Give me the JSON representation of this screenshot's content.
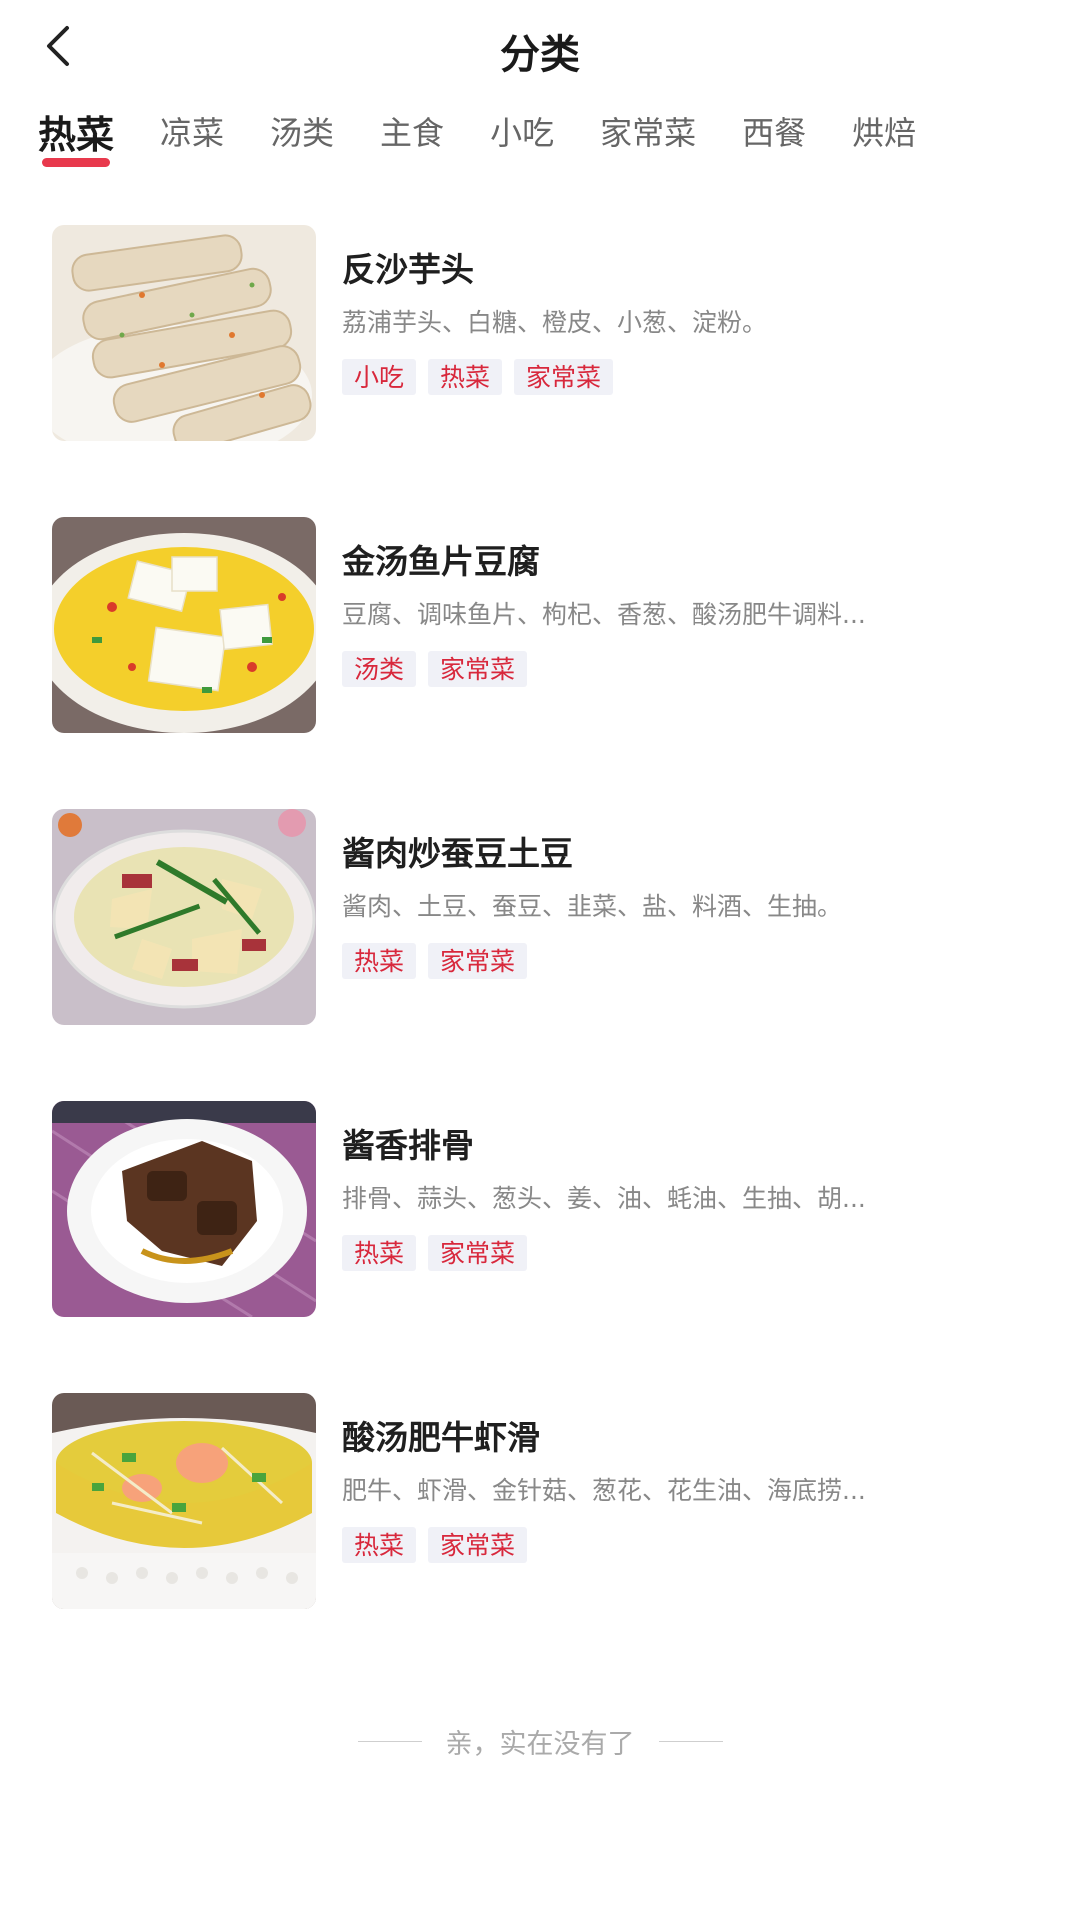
{
  "header": {
    "title": "分类",
    "back_icon": "chevron-left-icon"
  },
  "tabs": [
    {
      "label": "热菜",
      "active": true
    },
    {
      "label": "凉菜",
      "active": false
    },
    {
      "label": "汤类",
      "active": false
    },
    {
      "label": "主食",
      "active": false
    },
    {
      "label": "小吃",
      "active": false
    },
    {
      "label": "家常菜",
      "active": false
    },
    {
      "label": "西餐",
      "active": false
    },
    {
      "label": "烘焙",
      "active": false
    }
  ],
  "accent_color": "#e8394d",
  "recipes": [
    {
      "name": "反沙芋头",
      "ingredients": "荔浦芋头、白糖、橙皮、小葱、淀粉。",
      "tags": [
        "小吃",
        "热菜",
        "家常菜"
      ]
    },
    {
      "name": "金汤鱼片豆腐",
      "ingredients": "豆腐、调味鱼片、枸杞、香葱、酸汤肥牛调料...",
      "tags": [
        "汤类",
        "家常菜"
      ]
    },
    {
      "name": "酱肉炒蚕豆土豆",
      "ingredients": "酱肉、土豆、蚕豆、韭菜、盐、料酒、生抽。",
      "tags": [
        "热菜",
        "家常菜"
      ]
    },
    {
      "name": "酱香排骨",
      "ingredients": "排骨、蒜头、葱头、姜、油、蚝油、生抽、胡...",
      "tags": [
        "热菜",
        "家常菜"
      ]
    },
    {
      "name": "酸汤肥牛虾滑",
      "ingredients": "肥牛、虾滑、金针菇、葱花、花生油、海底捞...",
      "tags": [
        "热菜",
        "家常菜"
      ]
    }
  ],
  "footer": {
    "end_text": "亲，实在没有了"
  }
}
